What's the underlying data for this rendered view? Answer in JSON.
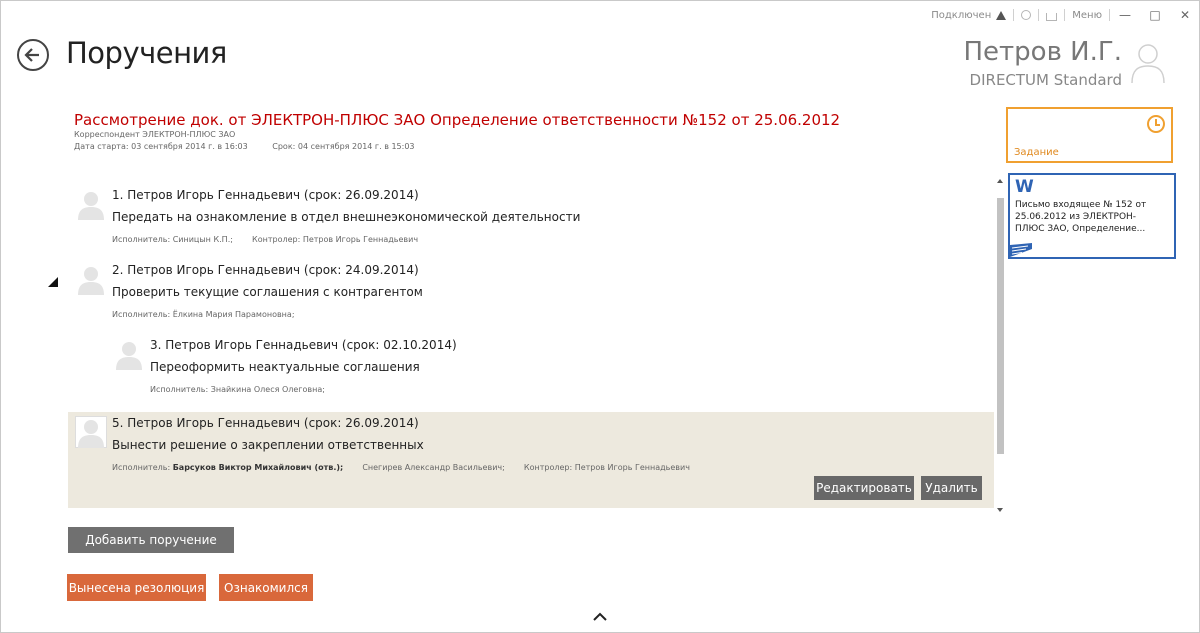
{
  "system_bar": {
    "status": "Подключен",
    "menu": "Меню"
  },
  "header": {
    "title": "Поручения",
    "user_name": "Петров И.Г.",
    "user_subtitle": "DIRECTUM Standard"
  },
  "document": {
    "title": "Рассмотрение док. от ЭЛЕКТРОН-ПЛЮС ЗАО Определение ответственности №152 от 25.06.2012",
    "correspondent": "Корреспондент ЭЛЕКТРОН-ПЛЮС ЗАО",
    "start_date": "Дата старта: 03 сентября 2014 г. в 16:03",
    "deadline": "Срок: 04 сентября 2014 г. в 15:03"
  },
  "assignments": [
    {
      "header": "1. Петров Игорь Геннадьевич (срок: 26.09.2014)",
      "task": "Передать на ознакомление в отдел внешнеэкономической деятельности",
      "executor_label": "Исполнитель:",
      "executor": "Синицын К.П.;",
      "controller_label": "Контролер:",
      "controller": "Петров Игорь Геннадьевич"
    },
    {
      "header": "2. Петров Игорь Геннадьевич (срок: 24.09.2014)",
      "task": "Проверить текущие соглашения с контрагентом",
      "executor_label": "Исполнитель:",
      "executor": "Ёлкина Мария Парамоновна;"
    },
    {
      "header": "3. Петров Игорь Геннадьевич (срок: 02.10.2014)",
      "task": "Переоформить неактуальные соглашения",
      "executor_label": "Исполнитель:",
      "executor": "Знайкина Олеся Олеговна;"
    },
    {
      "header": "5. Петров Игорь Геннадьевич (срок: 26.09.2014)",
      "task": "Вынести решение о закреплении ответственных",
      "executor_label": "Исполнитель:",
      "executor_main": "Барсуков Виктор Михайлович  (отв.);",
      "executor_second": "Снегирев Александр Васильевич;",
      "controller_label": "Контролер:",
      "controller": "Петров Игорь Геннадьевич",
      "edit_label": "Редактировать",
      "delete_label": "Удалить"
    }
  ],
  "actions": {
    "add_assignment": "Добавить поручение",
    "resolution": "Вынесена резолюция",
    "acknowledged": "Ознакомился"
  },
  "side_panel": {
    "task_tile_label": "Задание",
    "doc_tile_text": "Письмо входящее № 152 от 25.06.2012 из ЭЛЕКТРОН-ПЛЮС ЗАО,  Определение...",
    "doc_tile_icon": "W"
  },
  "colors": {
    "accent_red": "#c00000",
    "orange": "#d9683b",
    "task_tile": "#f0a030",
    "doc_tile": "#2f64b4",
    "selected_bg": "#ede9de"
  }
}
